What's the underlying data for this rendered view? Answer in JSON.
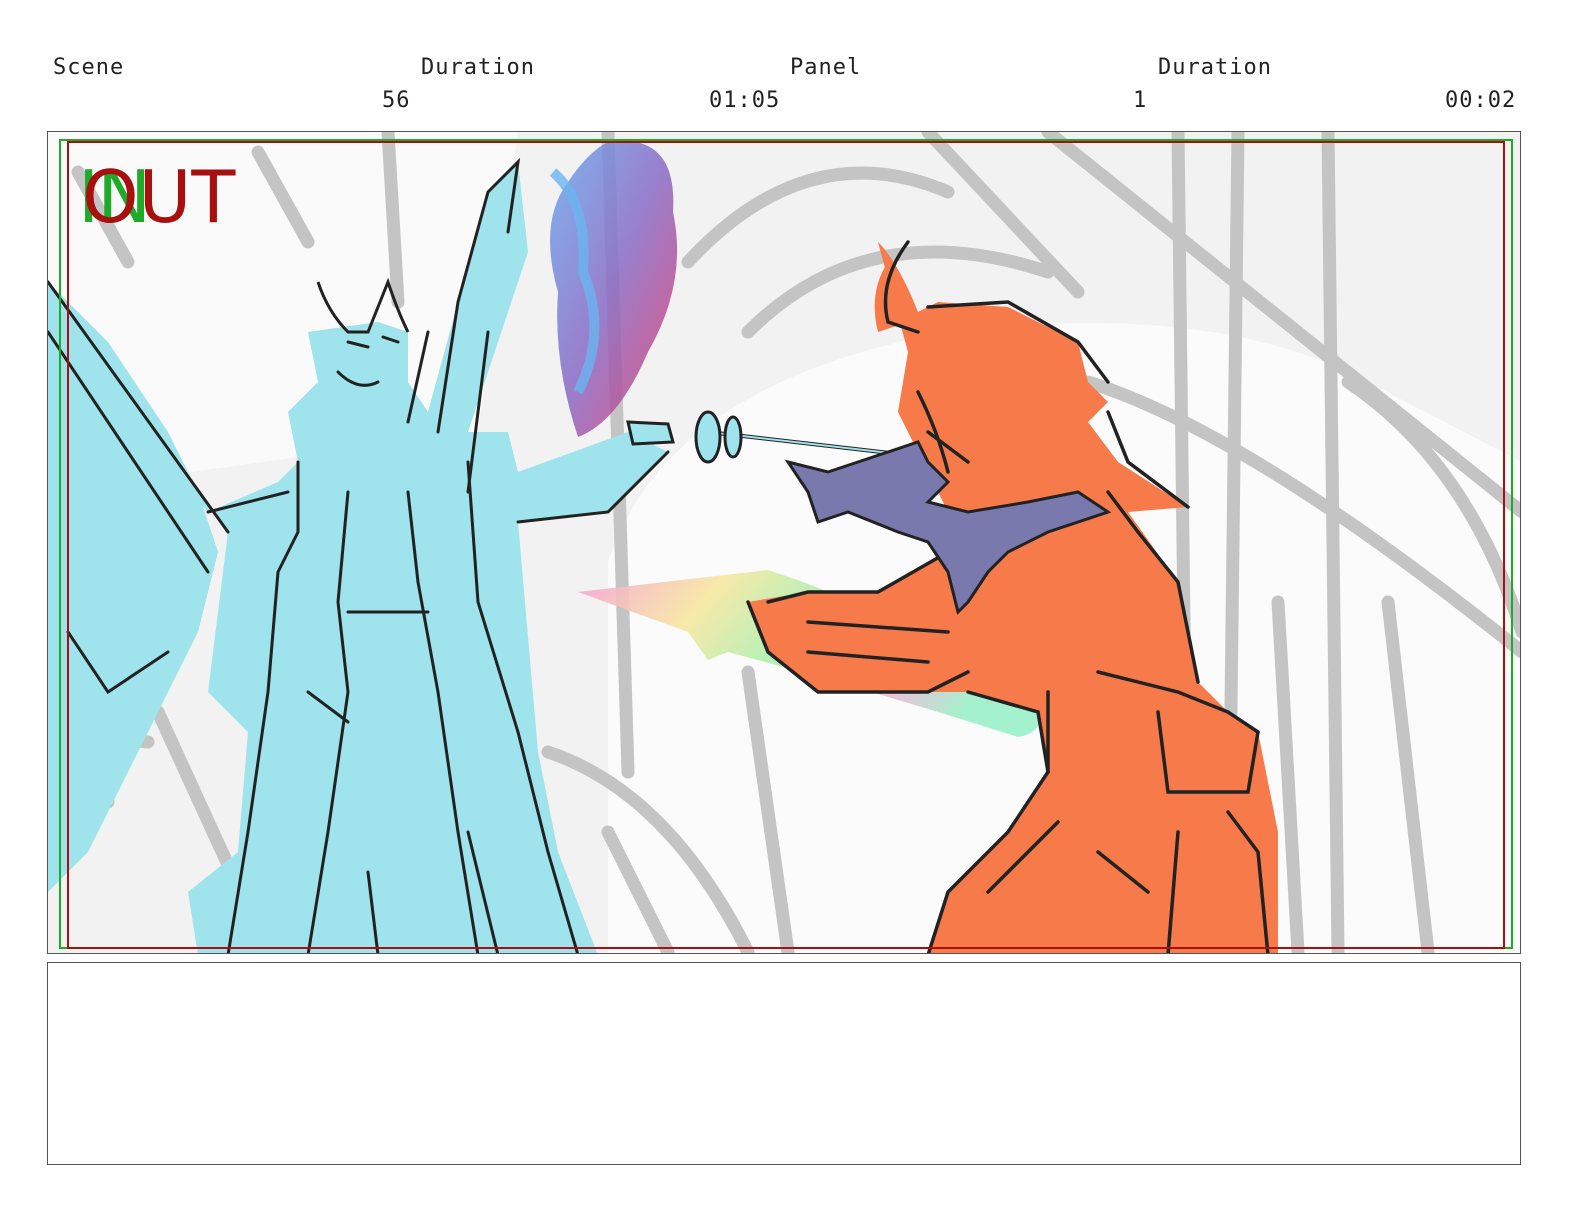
{
  "header": {
    "scene_label": "Scene",
    "scene_duration_label": "Duration",
    "panel_label": "Panel",
    "panel_duration_label": "Duration",
    "scene_value": "56",
    "scene_duration_value": "01:05",
    "panel_value": "1",
    "panel_duration_value": "00:02"
  },
  "frame": {
    "marker_in": "IN",
    "marker_out": "OUT",
    "marker_in_color": "#1faa2a",
    "marker_out_color": "#a80f0f",
    "left_character_color": "#9fe3ec",
    "right_character_color": "#f77a4a",
    "creature_color": "#7a79ae"
  },
  "notes": {
    "text": ""
  }
}
